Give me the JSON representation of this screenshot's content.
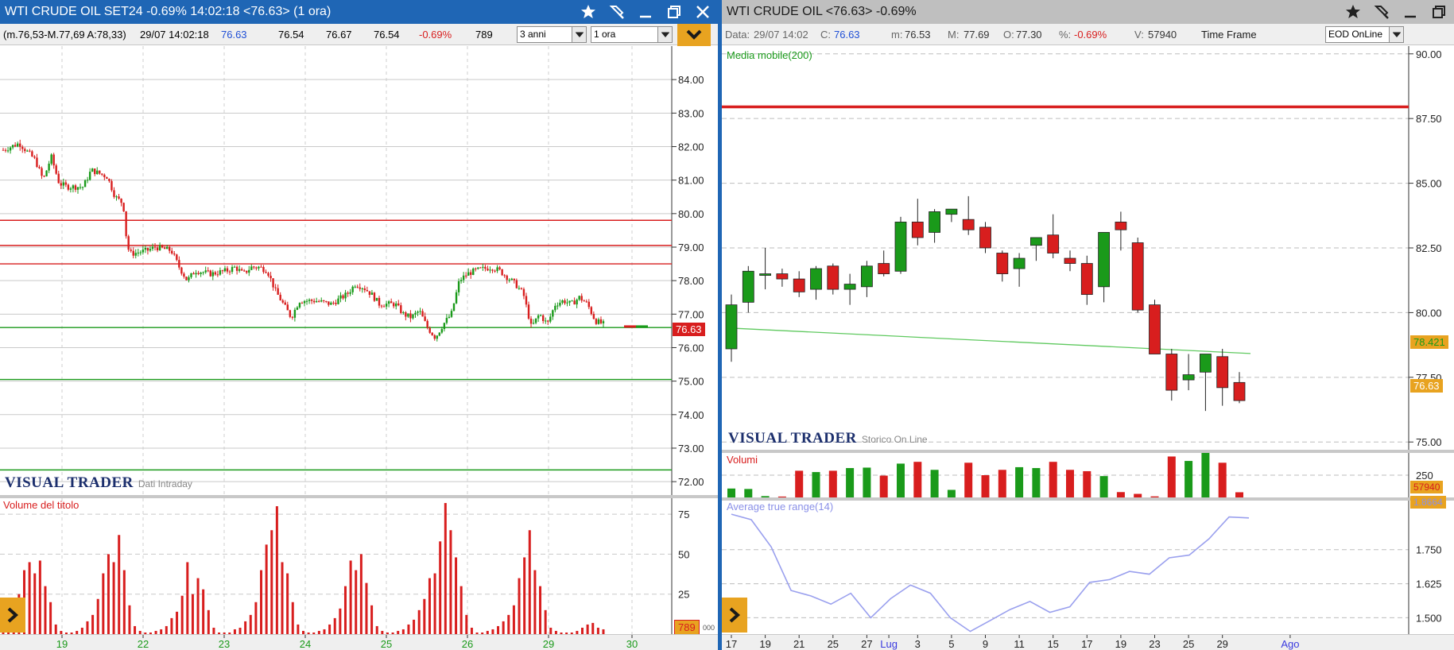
{
  "left": {
    "title": "WTI CRUDE OIL SET24 -0.69% 14:02:18  <76.63> (1 ora)",
    "info": {
      "range": "(m.76,53-M.77,69 A:78,33)",
      "datetime": "29/07 14:02:18",
      "last": "76.63",
      "v1": "76.54",
      "v2": "76.67",
      "v3": "76.54",
      "change": "-0.69%",
      "volume": "789"
    },
    "period_select": "3 anni",
    "interval_select": "1 ora",
    "watermark": "VISUAL TRADER",
    "watermark_sub": "Dati Intraday",
    "volume_label": "Volume del titolo",
    "price_tag": "76.63",
    "volume_tag": "789",
    "volume_tag_extra": "000"
  },
  "right": {
    "title": "WTI CRUDE OIL <76.63> -0.69%",
    "info": {
      "data_label": "Data:",
      "data_value": "29/07 14:02",
      "c_label": "C:",
      "c_value": "76.63",
      "m_label": "m:",
      "m_value": "76.53",
      "M_label": "M:",
      "M_value": "77.69",
      "o_label": "O:",
      "o_value": "77.30",
      "pct_label": "%:",
      "pct_value": "-0.69%",
      "v_label": "V:",
      "v_value": "57940"
    },
    "timeframe_label": "Time Frame",
    "timeframe_select": "EOD OnLine",
    "ma_label": "Media mobile(200)",
    "watermark": "VISUAL TRADER",
    "watermark_sub": "Storico On Line",
    "volume_label": "Volumi",
    "atr_label": "Average true range(14)",
    "ma_tag": "78.421",
    "price_tag": "76.63",
    "volume_tag": "57940",
    "atr_tag": "1.8664"
  },
  "colors": {
    "window_blue": "#1f66b5",
    "up": "#1a9a1a",
    "down": "#d81e1e",
    "accent": "#e8a320",
    "ma_line": "#5fc95f",
    "atr_line": "#9aa0ee"
  },
  "chart_data": [
    {
      "type": "candlestick",
      "title": "WTI CRUDE OIL SET24 (1 ora)",
      "x_ticks": [
        "19",
        "22",
        "23",
        "24",
        "25",
        "26",
        "29",
        "30"
      ],
      "y_ticks": [
        "84.00",
        "83.00",
        "82.00",
        "81.00",
        "80.00",
        "79.00",
        "78.00",
        "77.00",
        "76.00",
        "75.00",
        "74.00",
        "73.00",
        "72.00"
      ],
      "ylim": [
        71.6,
        85.0
      ],
      "close_path": [
        [
          0,
          81.9
        ],
        [
          2,
          82.1
        ],
        [
          4,
          81.6
        ],
        [
          5,
          81.0
        ],
        [
          6,
          81.7
        ],
        [
          7,
          80.9
        ],
        [
          8,
          80.8
        ],
        [
          10,
          80.8
        ],
        [
          11,
          81.3
        ],
        [
          13,
          81.1
        ],
        [
          14,
          80.5
        ],
        [
          15,
          80.3
        ],
        [
          15.5,
          79.0
        ],
        [
          16,
          78.8
        ],
        [
          18,
          78.9
        ],
        [
          19,
          79.0
        ],
        [
          21,
          78.9
        ],
        [
          22,
          78.4
        ],
        [
          23,
          78.0
        ],
        [
          24,
          78.3
        ],
        [
          26,
          78.2
        ],
        [
          28,
          78.3
        ],
        [
          29,
          78.4
        ],
        [
          30,
          78.2
        ],
        [
          31,
          78.4
        ],
        [
          32,
          78.4
        ],
        [
          33,
          78.3
        ],
        [
          34,
          77.7
        ],
        [
          35,
          77.3
        ],
        [
          36,
          76.9
        ],
        [
          37,
          77.4
        ],
        [
          39,
          77.4
        ],
        [
          41,
          77.3
        ],
        [
          43,
          77.6
        ],
        [
          44,
          77.9
        ],
        [
          45,
          77.8
        ],
        [
          46,
          77.6
        ],
        [
          47,
          77.3
        ],
        [
          49,
          77.3
        ],
        [
          50,
          77.0
        ],
        [
          51,
          76.9
        ],
        [
          52,
          77.1
        ],
        [
          53,
          76.6
        ],
        [
          54,
          76.3
        ],
        [
          55,
          76.7
        ],
        [
          56,
          77.0
        ],
        [
          57,
          78.0
        ],
        [
          58,
          78.2
        ],
        [
          59,
          78.3
        ],
        [
          61,
          78.4
        ],
        [
          62,
          78.3
        ],
        [
          63,
          78.1
        ],
        [
          64,
          77.9
        ],
        [
          65,
          77.6
        ],
        [
          66,
          76.6
        ],
        [
          67,
          77.0
        ],
        [
          68,
          76.7
        ],
        [
          69,
          77.3
        ],
        [
          70,
          77.4
        ],
        [
          71,
          77.3
        ],
        [
          72,
          77.5
        ],
        [
          73,
          77.3
        ],
        [
          74,
          76.8
        ],
        [
          75,
          76.7
        ]
      ],
      "hlines": [
        {
          "value": 79.8,
          "color": "#d81e1e"
        },
        {
          "value": 79.05,
          "color": "#d81e1e"
        },
        {
          "value": 78.5,
          "color": "#d81e1e"
        },
        {
          "value": 76.6,
          "color": "#1a9a1a"
        },
        {
          "value": 75.05,
          "color": "#1a9a1a"
        },
        {
          "value": 72.35,
          "color": "#1a9a1a"
        }
      ],
      "last": 76.63
    },
    {
      "type": "bar",
      "title": "Volume del titolo",
      "y_ticks": [
        "75",
        "50",
        "25"
      ],
      "ylim": [
        0,
        85
      ],
      "values": [
        2,
        5,
        12,
        25,
        40,
        45,
        38,
        46,
        30,
        20,
        6,
        2,
        1,
        1,
        2,
        4,
        8,
        12,
        22,
        38,
        50,
        45,
        62,
        40,
        18,
        5,
        2,
        1,
        1,
        2,
        3,
        5,
        10,
        14,
        24,
        45,
        25,
        35,
        28,
        15,
        4,
        1,
        1,
        1,
        3,
        4,
        8,
        12,
        20,
        40,
        56,
        65,
        80,
        45,
        38,
        20,
        6,
        2,
        1,
        1,
        2,
        3,
        6,
        10,
        16,
        30,
        46,
        40,
        50,
        32,
        18,
        5,
        2,
        1,
        1,
        2,
        3,
        6,
        9,
        15,
        22,
        35,
        38,
        58,
        82,
        65,
        48,
        30,
        12,
        4,
        1,
        1,
        2,
        3,
        5,
        8,
        12,
        18,
        35,
        48,
        65,
        40,
        30,
        15,
        4,
        2,
        1,
        1,
        1,
        2,
        4,
        6,
        7,
        4,
        3
      ],
      "last": 789
    },
    {
      "type": "candlestick",
      "title": "WTI CRUDE OIL EOD",
      "x_ticks": [
        "17",
        "19",
        "21",
        "25",
        "27",
        "Lug",
        "3",
        "5",
        "9",
        "11",
        "15",
        "17",
        "19",
        "23",
        "25",
        "29",
        "Ago"
      ],
      "y_ticks": [
        "90.00",
        "87.50",
        "85.00",
        "82.50",
        "80.00",
        "77.50",
        "75.00"
      ],
      "ylim": [
        74.7,
        90.3
      ],
      "candles": [
        {
          "o": 78.6,
          "h": 80.7,
          "l": 78.1,
          "c": 80.3
        },
        {
          "o": 80.4,
          "h": 81.8,
          "l": 80.0,
          "c": 81.6
        },
        {
          "o": 81.5,
          "h": 82.5,
          "l": 80.9,
          "c": 81.5
        },
        {
          "o": 81.5,
          "h": 81.7,
          "l": 81.0,
          "c": 81.3
        },
        {
          "o": 81.3,
          "h": 81.6,
          "l": 80.6,
          "c": 80.8
        },
        {
          "o": 80.9,
          "h": 81.8,
          "l": 80.5,
          "c": 81.7
        },
        {
          "o": 81.8,
          "h": 81.9,
          "l": 80.7,
          "c": 80.9
        },
        {
          "o": 80.9,
          "h": 81.5,
          "l": 80.3,
          "c": 81.1
        },
        {
          "o": 81.0,
          "h": 82.0,
          "l": 80.6,
          "c": 81.8
        },
        {
          "o": 81.9,
          "h": 82.4,
          "l": 81.4,
          "c": 81.5
        },
        {
          "o": 81.6,
          "h": 83.7,
          "l": 81.5,
          "c": 83.5
        },
        {
          "o": 83.5,
          "h": 84.4,
          "l": 82.6,
          "c": 82.9
        },
        {
          "o": 83.1,
          "h": 84.0,
          "l": 82.7,
          "c": 83.9
        },
        {
          "o": 83.8,
          "h": 84.0,
          "l": 83.5,
          "c": 84.0
        },
        {
          "o": 83.6,
          "h": 84.5,
          "l": 83.0,
          "c": 83.2
        },
        {
          "o": 83.3,
          "h": 83.5,
          "l": 82.3,
          "c": 82.5
        },
        {
          "o": 82.3,
          "h": 82.4,
          "l": 81.2,
          "c": 81.5
        },
        {
          "o": 81.7,
          "h": 82.3,
          "l": 81.0,
          "c": 82.1
        },
        {
          "o": 82.6,
          "h": 82.9,
          "l": 82.0,
          "c": 82.9
        },
        {
          "o": 83.0,
          "h": 83.8,
          "l": 82.1,
          "c": 82.3
        },
        {
          "o": 82.1,
          "h": 82.4,
          "l": 81.6,
          "c": 81.9
        },
        {
          "o": 81.9,
          "h": 82.2,
          "l": 80.3,
          "c": 80.7
        },
        {
          "o": 81.0,
          "h": 83.1,
          "l": 80.4,
          "c": 83.1
        },
        {
          "o": 83.5,
          "h": 83.9,
          "l": 82.4,
          "c": 83.2
        },
        {
          "o": 82.7,
          "h": 82.9,
          "l": 80.0,
          "c": 80.1
        },
        {
          "o": 80.3,
          "h": 80.5,
          "l": 78.4,
          "c": 78.4
        },
        {
          "o": 78.4,
          "h": 78.6,
          "l": 76.6,
          "c": 77.0
        },
        {
          "o": 77.4,
          "h": 78.4,
          "l": 77.0,
          "c": 77.6
        },
        {
          "o": 77.7,
          "h": 78.4,
          "l": 76.2,
          "c": 78.4
        },
        {
          "o": 78.3,
          "h": 78.6,
          "l": 76.4,
          "c": 77.1
        },
        {
          "o": 77.3,
          "h": 77.7,
          "l": 76.5,
          "c": 76.6
        }
      ],
      "moving_average": {
        "name": "Media mobile(200)",
        "start": 79.4,
        "end": 78.42
      },
      "hline": {
        "value": 87.95,
        "color": "#d81e1e"
      }
    },
    {
      "type": "bar",
      "title": "Volumi",
      "y_ticks": [
        "250"
      ],
      "ylim": [
        0,
        500
      ],
      "values": [
        100,
        95,
        15,
        10,
        300,
        285,
        300,
        330,
        335,
        245,
        380,
        400,
        310,
        85,
        390,
        250,
        310,
        340,
        330,
        400,
        310,
        295,
        240,
        60,
        40,
        12,
        460,
        410,
        500,
        390,
        58
      ]
    },
    {
      "type": "line",
      "title": "Average true range(14)",
      "y_ticks": [
        "1.750",
        "1.625",
        "1.500"
      ],
      "ylim": [
        1.44,
        1.93
      ],
      "values": [
        1.88,
        1.86,
        1.76,
        1.6,
        1.58,
        1.55,
        1.59,
        1.5,
        1.57,
        1.62,
        1.59,
        1.5,
        1.45,
        1.49,
        1.53,
        1.56,
        1.52,
        1.54,
        1.63,
        1.64,
        1.67,
        1.66,
        1.72,
        1.73,
        1.79,
        1.87,
        1.8664
      ],
      "last": 1.8664
    }
  ]
}
